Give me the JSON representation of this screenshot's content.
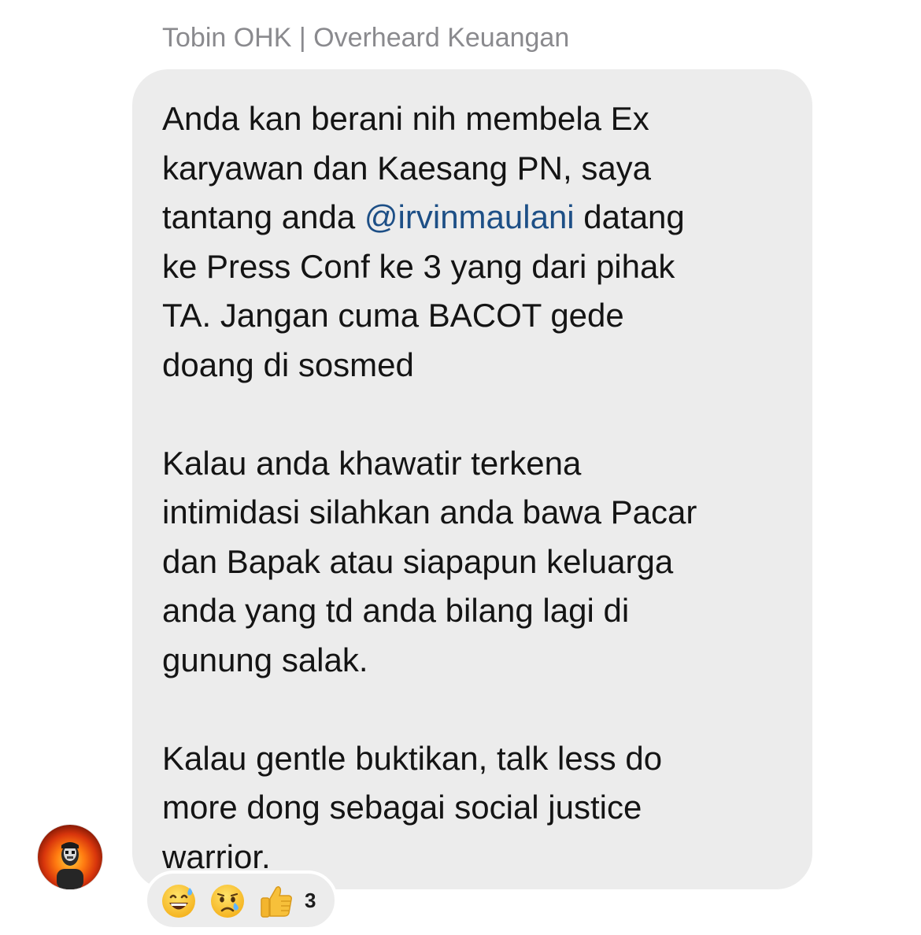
{
  "message": {
    "sender": "Tobin OHK | Overheard Keuangan",
    "paragraphs": [
      [
        "Anda kan berani nih membela Ex",
        "karyawan dan Kaesang PN, saya",
        "tantang anda ",
        "ke Press Conf ke 3 yang dari pihak",
        "TA. Jangan cuma BACOT gede",
        "doang di sosmed"
      ],
      [
        "Kalau anda khawatir terkena",
        "intimidasi silahkan anda bawa Pacar",
        "dan Bapak atau siapapun keluarga",
        "anda yang td anda bilang lagi di",
        "gunung salak."
      ],
      [
        "Kalau gentle buktikan, talk less do",
        "more dong sebagai social justice",
        "warrior."
      ]
    ],
    "mention": "@irvinmaulani",
    "mention_suffix": " datang"
  },
  "reactions": {
    "emojis": [
      "grinning-sweat-emoji",
      "crying-face-emoji",
      "thumbs-up-emoji"
    ],
    "count": "3"
  },
  "colors": {
    "bubble": "#ececec",
    "mention": "#1d4f86",
    "sender": "#8a8a8e"
  }
}
